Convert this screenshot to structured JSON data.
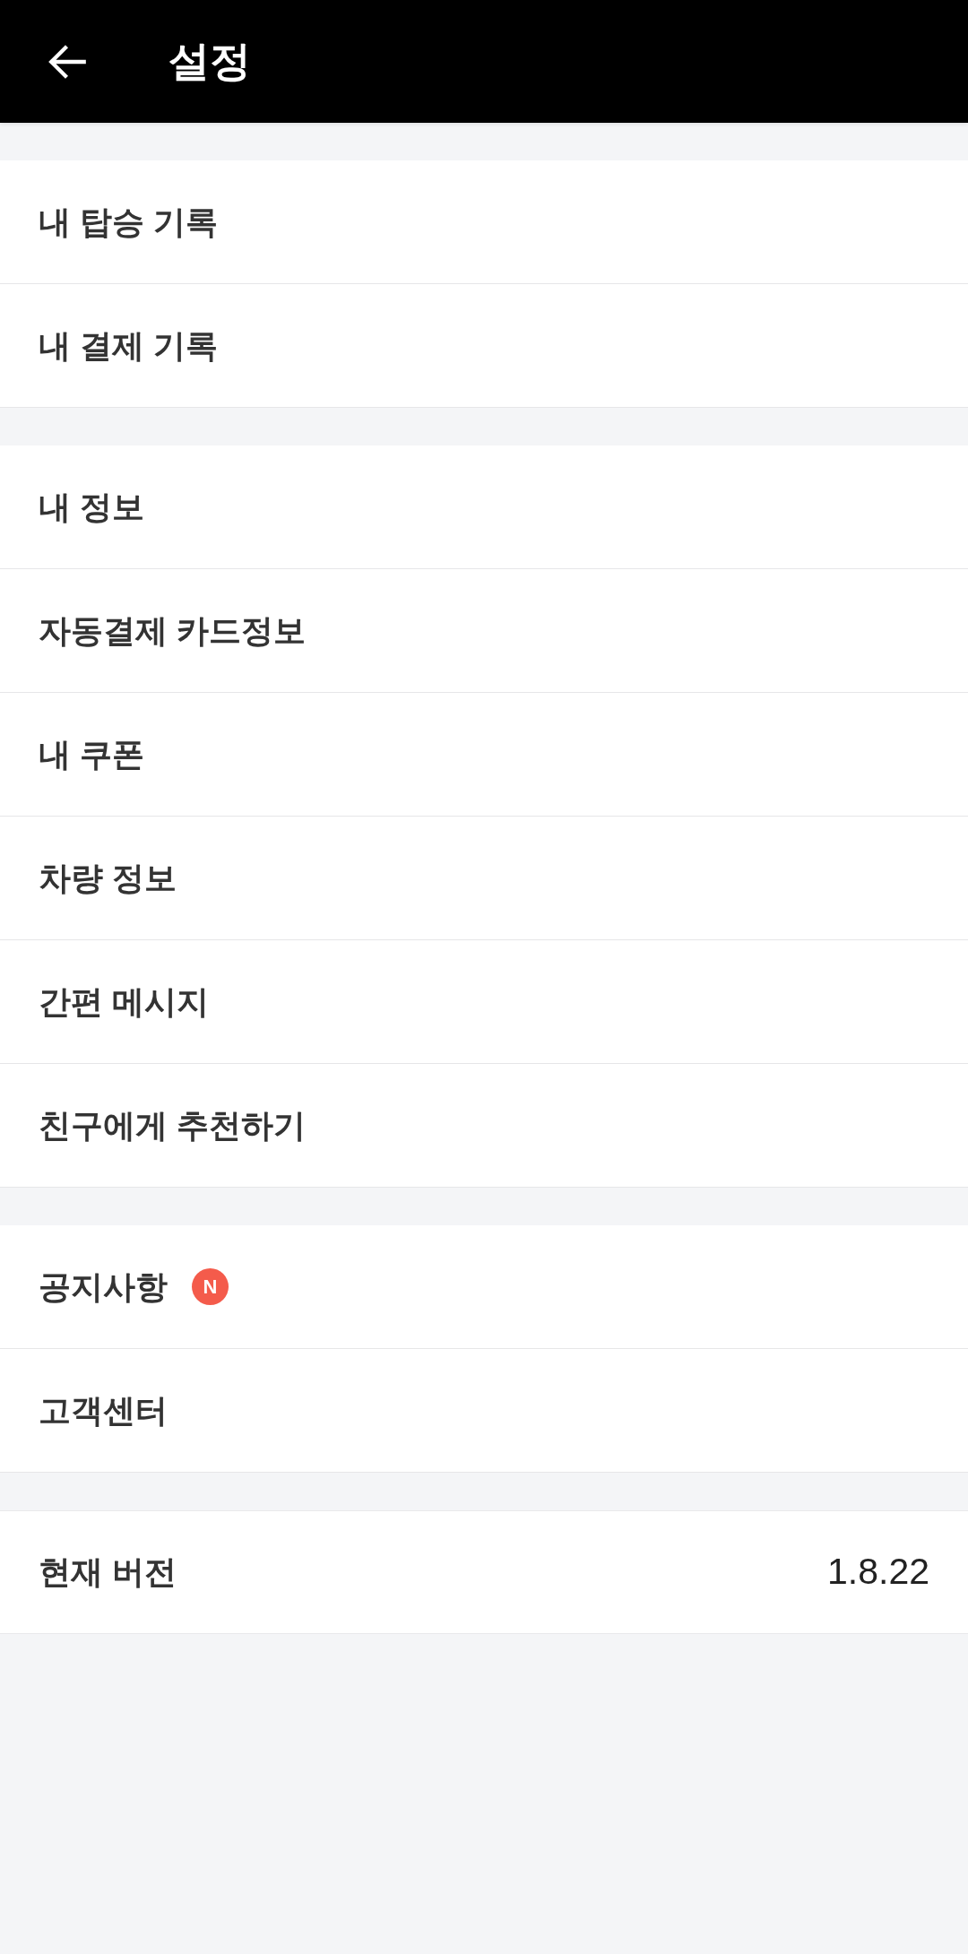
{
  "header": {
    "title": "설정"
  },
  "sections": [
    {
      "items": [
        {
          "label": "내 탑승 기록"
        },
        {
          "label": "내 결제 기록"
        }
      ]
    },
    {
      "items": [
        {
          "label": "내 정보"
        },
        {
          "label": "자동결제 카드정보"
        },
        {
          "label": "내 쿠폰"
        },
        {
          "label": "차량 정보"
        },
        {
          "label": "간편 메시지"
        },
        {
          "label": "친구에게 추천하기"
        }
      ]
    },
    {
      "items": [
        {
          "label": "공지사항",
          "badge": "N"
        },
        {
          "label": "고객센터"
        }
      ]
    },
    {
      "items": [
        {
          "label": "현재 버전",
          "value": "1.8.22"
        }
      ]
    }
  ]
}
